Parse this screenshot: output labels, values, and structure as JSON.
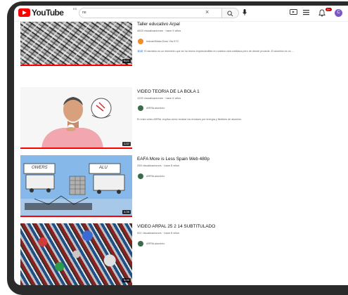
{
  "header": {
    "logo_text": "YouTube",
    "logo_country": "ES",
    "search_value": "no",
    "notification_count": "9+",
    "avatar_letter": "C",
    "colors": {
      "brand": "#ff0000",
      "avatar": "#7b56c9"
    }
  },
  "videos": [
    {
      "title": "Taller educativo Arpal",
      "meta": "4603 visualizaciones · hace 9 años",
      "channel": "IndustriMaka Dosx Via K7C",
      "channel_avatar_color": "#f28c28",
      "desc_highlight": "8:12",
      "description": "El aluminio es un elemento que se ha hecho imprescindible en nuestra vida cotidiana pero de dónde procede. El aluminio es un ...",
      "duration": "8:21",
      "progress": 1.0
    },
    {
      "title": "VIDEO TEORIA DE LA BOLA 1",
      "meta": "1220 visualizaciones · hace 6 años",
      "channel": "ARPALaluminio",
      "channel_avatar_color": "#3a6b4a",
      "description": "En este vídeo ARPAL explica cómo reciclar los envases por energía y flexibles de aluminio.",
      "duration": "1:37",
      "progress": 1.0
    },
    {
      "title": "EAFA More is Less Spain Web 480p",
      "meta": "255 visualizaciones · hace 8 años",
      "channel": "ARPALaluminio",
      "channel_avatar_color": "#3a6b4a",
      "duration": "4:39",
      "progress": 1.0,
      "thumb_labels": [
        "OWERS",
        "ALU"
      ]
    },
    {
      "title": "VIDEO ARPAL 25 2 14 SUBTITULADO",
      "meta": "921 visualizaciones · hace 8 años",
      "channel": "ARPALaluminio",
      "channel_avatar_color": "#3a6b4a",
      "duration": "6:30",
      "progress": 1.0
    }
  ]
}
